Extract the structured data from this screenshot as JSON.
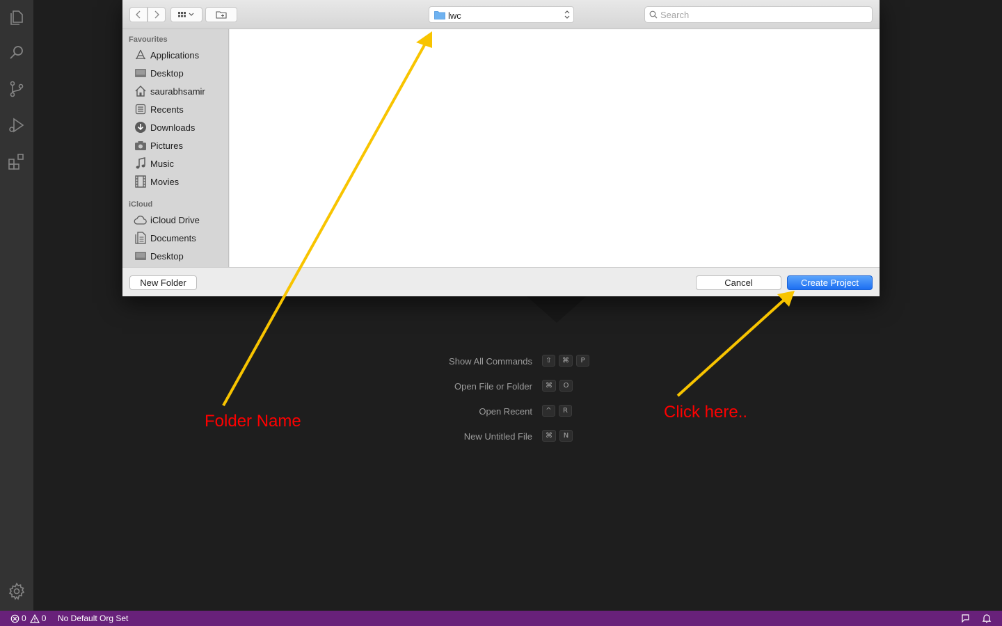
{
  "dialog": {
    "path_label": "lwc",
    "search_placeholder": "Search",
    "sidebar": {
      "favourites_label": "Favourites",
      "favourites": [
        {
          "label": "Applications",
          "icon": "applications-icon"
        },
        {
          "label": "Desktop",
          "icon": "desktop-icon"
        },
        {
          "label": "saurabhsamir",
          "icon": "home-icon"
        },
        {
          "label": "Recents",
          "icon": "recents-icon"
        },
        {
          "label": "Downloads",
          "icon": "downloads-icon"
        },
        {
          "label": "Pictures",
          "icon": "camera-icon"
        },
        {
          "label": "Music",
          "icon": "music-icon"
        },
        {
          "label": "Movies",
          "icon": "film-icon"
        }
      ],
      "icloud_label": "iCloud",
      "icloud": [
        {
          "label": "iCloud Drive",
          "icon": "cloud-icon"
        },
        {
          "label": "Documents",
          "icon": "documents-icon"
        },
        {
          "label": "Desktop",
          "icon": "desktop-icon"
        }
      ]
    },
    "new_folder_label": "New Folder",
    "cancel_label": "Cancel",
    "create_label": "Create Project"
  },
  "shortcuts": [
    {
      "label": "Show All Commands",
      "keys": [
        "⇧",
        "⌘",
        "P"
      ]
    },
    {
      "label": "Open File or Folder",
      "keys": [
        "⌘",
        "O"
      ]
    },
    {
      "label": "Open Recent",
      "keys": [
        "^",
        "R"
      ]
    },
    {
      "label": "New Untitled File",
      "keys": [
        "⌘",
        "N"
      ]
    }
  ],
  "status_bar": {
    "errors": "0",
    "warnings": "0",
    "org": "No Default Org Set"
  },
  "annotations": {
    "folder_name": "Folder Name",
    "click_here": "Click here.."
  },
  "colors": {
    "status_bar": "#68217a",
    "annotation_arrow": "#f8c400",
    "annotation_text": "#ff0000",
    "primary_button": "#1d6ff2"
  }
}
